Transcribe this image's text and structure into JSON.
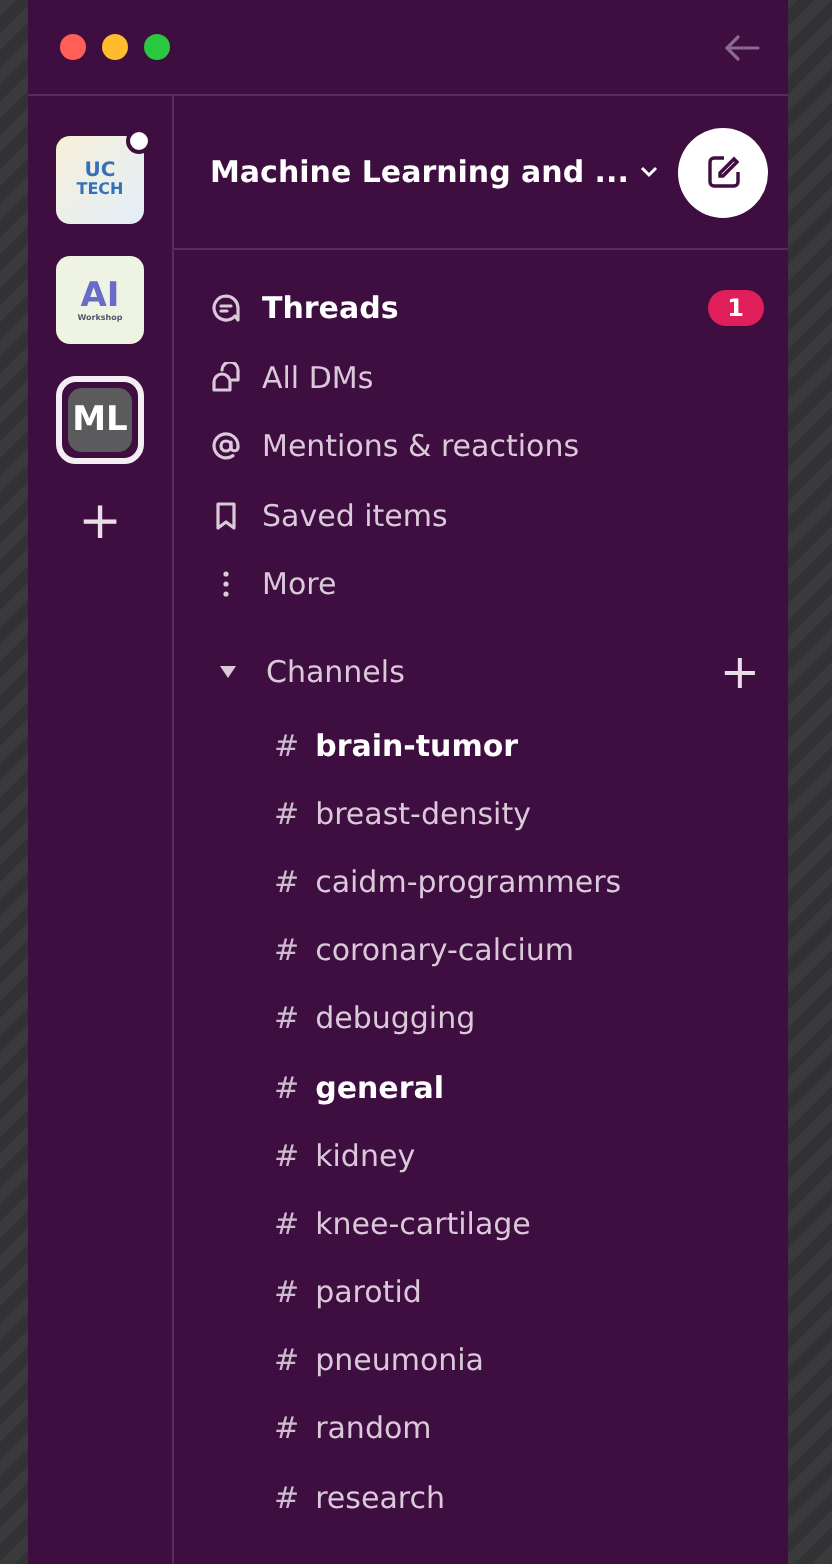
{
  "workspaces": [
    {
      "kind": "uctech",
      "label": "UC",
      "sublabel": "TECH",
      "selected": false,
      "unread": true
    },
    {
      "kind": "ai",
      "label": "AI",
      "sublabel": "Workshop",
      "selected": false,
      "unread": false
    },
    {
      "kind": "initials",
      "label": "ML",
      "selected": true,
      "unread": false
    }
  ],
  "add_workspace": "+",
  "workspace_name": "Machine Learning and ...",
  "nav": [
    {
      "kind": "threads",
      "label": "Threads",
      "unread": true,
      "badge": "1"
    },
    {
      "kind": "dms",
      "label": "All DMs",
      "unread": false
    },
    {
      "kind": "mentions",
      "label": "Mentions & reactions",
      "unread": false
    },
    {
      "kind": "saved",
      "label": "Saved items",
      "unread": false
    },
    {
      "kind": "more",
      "label": "More",
      "unread": false
    }
  ],
  "channels": {
    "title": "Channels",
    "expanded": true,
    "add": "+",
    "items": [
      {
        "prefix": "#",
        "name": "brain-tumor",
        "unread": true
      },
      {
        "prefix": "#",
        "name": "breast-density",
        "unread": false
      },
      {
        "prefix": "#",
        "name": "caidm-programmers",
        "unread": false
      },
      {
        "prefix": "#",
        "name": "coronary-calcium",
        "unread": false
      },
      {
        "prefix": "#",
        "name": "debugging",
        "unread": false
      },
      {
        "prefix": "#",
        "name": "general",
        "unread": true
      },
      {
        "prefix": "#",
        "name": "kidney",
        "unread": false
      },
      {
        "prefix": "#",
        "name": "knee-cartilage",
        "unread": false
      },
      {
        "prefix": "#",
        "name": "parotid",
        "unread": false
      },
      {
        "prefix": "#",
        "name": "pneumonia",
        "unread": false
      },
      {
        "prefix": "#",
        "name": "random",
        "unread": false
      },
      {
        "prefix": "#",
        "name": "research",
        "unread": false
      }
    ]
  }
}
